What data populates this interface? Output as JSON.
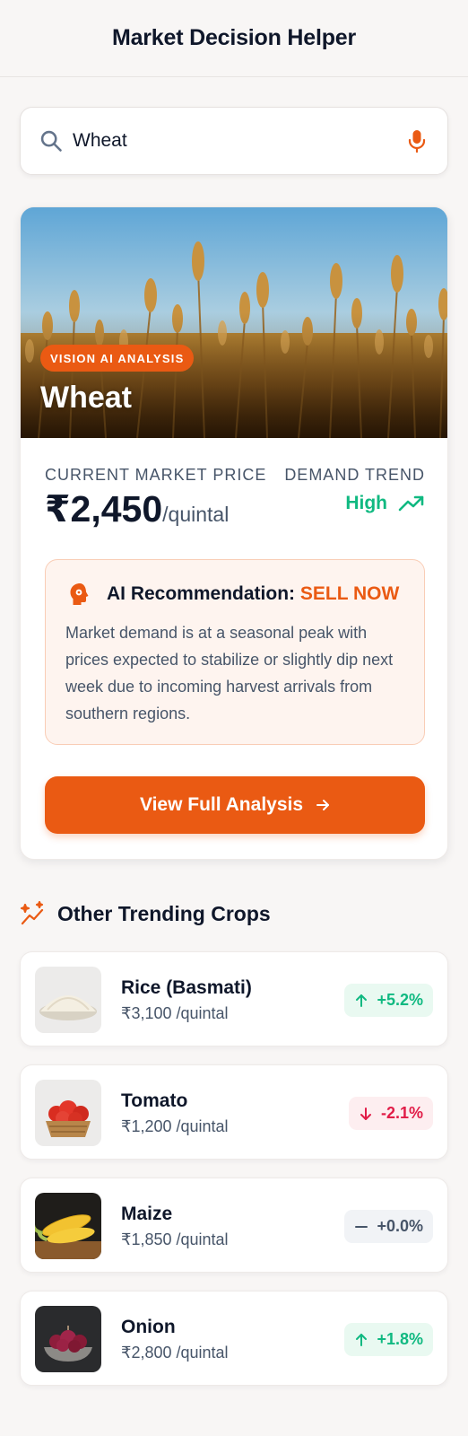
{
  "header": {
    "title": "Market Decision Helper"
  },
  "search": {
    "value": "Wheat",
    "placeholder": ""
  },
  "featured": {
    "badge": "VISION AI ANALYSIS",
    "crop_name": "Wheat",
    "price_label": "CURRENT MARKET PRICE",
    "price": "₹2,450",
    "price_unit": "/quintal",
    "trend_label": "DEMAND TREND",
    "trend_value": "High",
    "recommendation_prefix": "AI Recommendation:",
    "recommendation_action": "SELL NOW",
    "recommendation_text": "Market demand is at a seasonal peak with prices expected to stabilize or slightly dip next week due to incoming harvest arrivals from southern regions.",
    "cta_label": "View Full Analysis"
  },
  "trending": {
    "title": "Other Trending Crops",
    "items": [
      {
        "name": "Rice (Basmati)",
        "price": "₹3,100 /quintal",
        "change": "+5.2%",
        "direction": "up"
      },
      {
        "name": "Tomato",
        "price": "₹1,200 /quintal",
        "change": "-2.1%",
        "direction": "down"
      },
      {
        "name": "Maize",
        "price": "₹1,850 /quintal",
        "change": "+0.0%",
        "direction": "flat"
      },
      {
        "name": "Onion",
        "price": "₹2,800 /quintal",
        "change": "+1.8%",
        "direction": "up"
      }
    ]
  },
  "icons": {
    "search": "search-icon",
    "mic": "mic-icon",
    "trend": "trending-up-icon",
    "recommendation": "ai-brain-icon",
    "cta": "arrow-right-icon",
    "trending_header": "sparkle-icon"
  },
  "colors": {
    "accent": "#ea5a13",
    "positive": "#10b981",
    "negative": "#e11d48",
    "neutral": "#475569",
    "background": "#f8f6f5"
  }
}
